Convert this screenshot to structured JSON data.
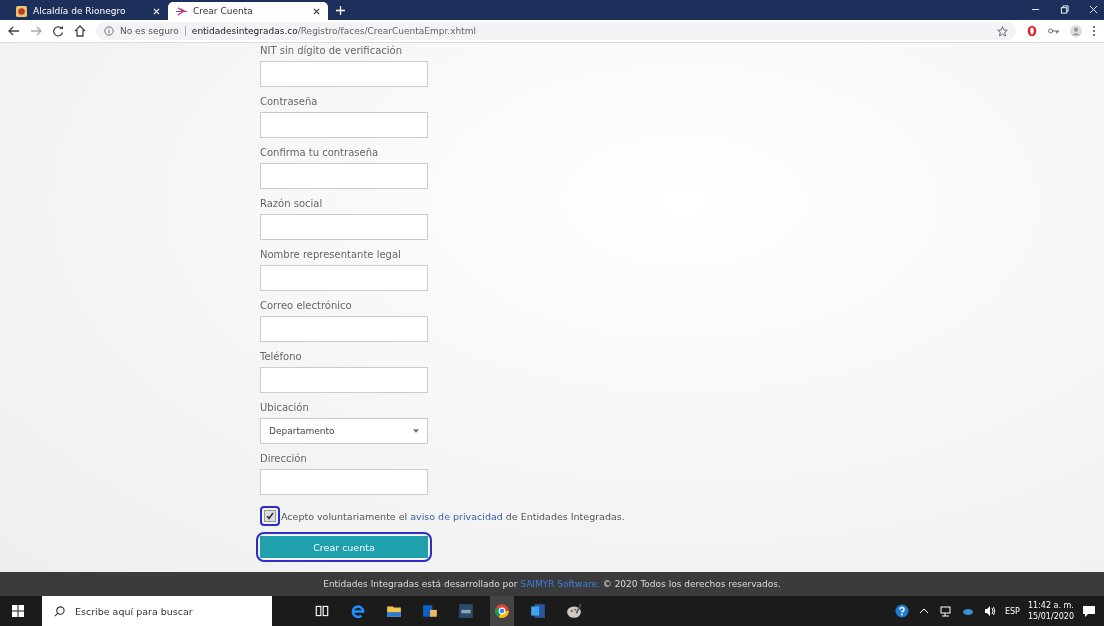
{
  "tabs": [
    {
      "title": "Alcaldía de Rionegro",
      "selected": false
    },
    {
      "title": "Crear Cuenta",
      "selected": true
    }
  ],
  "address_bar": {
    "security": "No es seguro",
    "host": "entidadesintegradas.co",
    "path": "/Registro/faces/CrearCuentaEmpr.xhtml"
  },
  "form": {
    "fields": [
      {
        "label": "NIT sin dígito de verificación",
        "kind": "text"
      },
      {
        "label": "Contraseña",
        "kind": "text"
      },
      {
        "label": "Confirma tu contraseña",
        "kind": "text"
      },
      {
        "label": "Razón social",
        "kind": "text"
      },
      {
        "label": "Nombre representante legal",
        "kind": "text"
      },
      {
        "label": "Correo electrónico",
        "kind": "text"
      },
      {
        "label": "Teléfono",
        "kind": "text"
      },
      {
        "label": "Ubicación",
        "kind": "select",
        "value": "Departamento"
      },
      {
        "label": "Dirección",
        "kind": "text"
      }
    ],
    "consent": {
      "checked": true,
      "highlighted": true,
      "before": "Acepto voluntariamente el ",
      "link": "aviso de privacidad",
      "after": " de Entidades Integradas."
    },
    "submit": {
      "label": "Crear cuenta",
      "highlighted": true
    }
  },
  "footer": {
    "before": "Entidades Integradas está desarrollado por ",
    "link": "SAIMYR Software.",
    "after": " © 2020 Todos los derechos reservados."
  },
  "taskbar": {
    "search_placeholder": "Escribe aquí para buscar",
    "language": "ESP",
    "time": "11:42 a. m.",
    "date": "15/01/2020"
  }
}
